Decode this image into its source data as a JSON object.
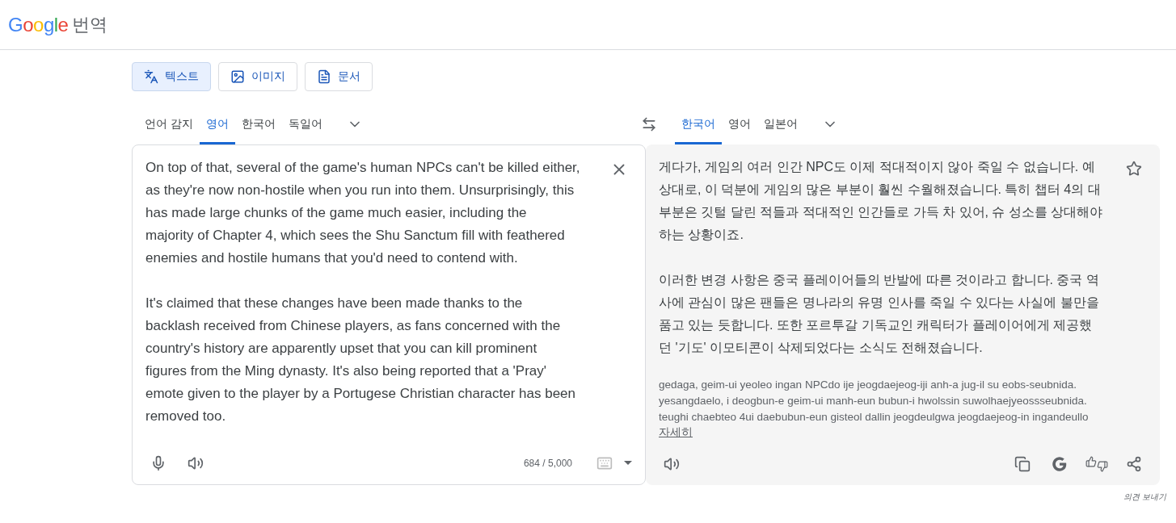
{
  "header": {
    "logo": "Google",
    "title": "번역"
  },
  "modes": [
    {
      "label": "텍스트",
      "kind": "text",
      "selected": true
    },
    {
      "label": "이미지",
      "kind": "image",
      "selected": false
    },
    {
      "label": "문서",
      "kind": "document",
      "selected": false
    }
  ],
  "source_languages": [
    {
      "label": "언어 감지",
      "selected": false
    },
    {
      "label": "영어",
      "selected": true
    },
    {
      "label": "한국어",
      "selected": false
    },
    {
      "label": "독일어",
      "selected": false
    }
  ],
  "target_languages": [
    {
      "label": "한국어",
      "selected": true
    },
    {
      "label": "영어",
      "selected": false
    },
    {
      "label": "일본어",
      "selected": false
    }
  ],
  "source": {
    "paragraphs": [
      "On top of that, several of the game's human NPCs can't be killed either,\nas they're now non-hostile when you run into them. Unsurprisingly, this\nhas made large chunks of the game much easier, including the\nmajority of Chapter 4, which sees the Shu Sanctum fill with feathered\nenemies and hostile humans that you'd need to contend with.",
      "It's claimed that these changes have been made thanks to the\nbacklash received from Chinese players, as fans concerned with the\ncountry's history are apparently upset that you can kill prominent\nfigures from the Ming dynasty. It's also being reported that a 'Pray'\nemote given to the player by a Portugese Christian character has been\nremoved too."
    ],
    "counter": "684 / 5,000"
  },
  "translation": {
    "paragraphs": [
      "게다가, 게임의 여러 인간 NPC도 이제 적대적이지 않아 죽일 수 없습니다. 예\n상대로, 이 덕분에 게임의 많은 부분이 훨씬 수월해졌습니다. 특히 챕터 4의 대\n부분은 깃털 달린 적들과 적대적인 인간들로 가득 차 있어, 슈 성소를 상대해야\n하는 상황이죠.",
      "이러한 변경 사항은 중국 플레이어들의 반발에 따른 것이라고 합니다. 중국 역\n사에 관심이 많은 팬들은 명나라의 유명 인사를 죽일 수 있다는 사실에 불만을\n품고 있는 듯합니다. 또한 포르투갈 기독교인 캐릭터가 플레이어에게 제공했\n던 '기도' 이모티콘이 삭제되었다는 소식도 전해졌습니다."
    ],
    "romanization": "gedaga, geim-ui yeoleo ingan NPCdo ije jeogdaejeog-iji anh-a jug-il su eobs-seubnida.\nyesangdaelo, i deogbun-e geim-ui manh-eun bubun-i hwolssin suwolhaejyeossseubnida.\nteughi chaebteo 4ui daebubun-eun gisteol dallin jeogdeulgwa jeogdaejeog-in ingandeullo",
    "more_link": "자세히"
  },
  "feedback_link": "의견 보내기"
}
